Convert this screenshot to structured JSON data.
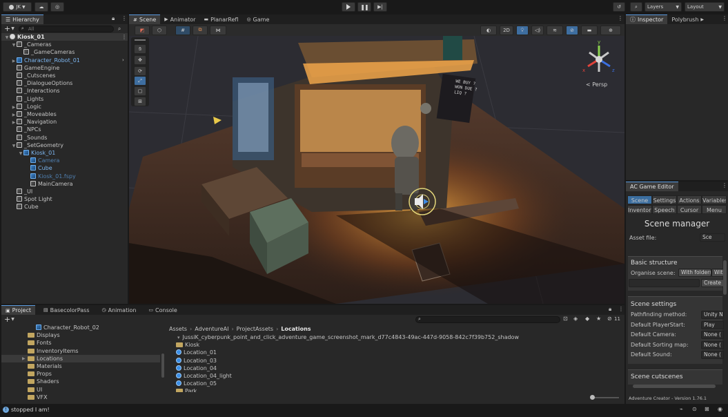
{
  "toolbar": {
    "account": "JK",
    "layers": "Layers",
    "layout": "Layout"
  },
  "hierarchy": {
    "tab": "Hierarchy",
    "search_placeholder": "All",
    "items": [
      {
        "label": "Kiosk_01",
        "indent": 0,
        "icon": "unity-scene-icon",
        "arrow": "down",
        "color": "#e6e6e6",
        "bold": true
      },
      {
        "label": "_Cameras",
        "indent": 1,
        "icon": "gameobject-icon",
        "arrow": "down",
        "color": "#c4c4c4"
      },
      {
        "label": "_GameCameras",
        "indent": 2,
        "icon": "gameobject-icon",
        "arrow": "",
        "color": "#c4c4c4"
      },
      {
        "label": "Character_Robot_01",
        "indent": 1,
        "icon": "prefab-icon",
        "arrow": "right",
        "color": "#7db6f0"
      },
      {
        "label": "GameEngine",
        "indent": 1,
        "icon": "gameobject-icon",
        "arrow": "",
        "color": "#c4c4c4"
      },
      {
        "label": "_Cutscenes",
        "indent": 1,
        "icon": "gameobject-icon",
        "arrow": "",
        "color": "#c4c4c4"
      },
      {
        "label": "_DialogueOptions",
        "indent": 1,
        "icon": "gameobject-icon",
        "arrow": "",
        "color": "#c4c4c4"
      },
      {
        "label": "_Interactions",
        "indent": 1,
        "icon": "gameobject-icon",
        "arrow": "",
        "color": "#c4c4c4"
      },
      {
        "label": "_Lights",
        "indent": 1,
        "icon": "gameobject-icon",
        "arrow": "",
        "color": "#c4c4c4"
      },
      {
        "label": "_Logic",
        "indent": 1,
        "icon": "gameobject-icon",
        "arrow": "right",
        "color": "#c4c4c4"
      },
      {
        "label": "_Moveables",
        "indent": 1,
        "icon": "gameobject-icon",
        "arrow": "right",
        "color": "#c4c4c4"
      },
      {
        "label": "_Navigation",
        "indent": 1,
        "icon": "gameobject-icon",
        "arrow": "right",
        "color": "#c4c4c4"
      },
      {
        "label": "_NPCs",
        "indent": 1,
        "icon": "gameobject-icon",
        "arrow": "",
        "color": "#c4c4c4"
      },
      {
        "label": "_Sounds",
        "indent": 1,
        "icon": "gameobject-icon",
        "arrow": "",
        "color": "#c4c4c4"
      },
      {
        "label": "_SetGeometry",
        "indent": 1,
        "icon": "gameobject-icon",
        "arrow": "down",
        "color": "#c4c4c4"
      },
      {
        "label": "Kiosk_01",
        "indent": 2,
        "icon": "prefab-icon",
        "arrow": "down",
        "color": "#7db6f0"
      },
      {
        "label": "Camera",
        "indent": 3,
        "icon": "prefab-icon",
        "arrow": "",
        "color": "#4f7fb0"
      },
      {
        "label": "Cube",
        "indent": 3,
        "icon": "prefab-icon",
        "arrow": "",
        "color": "#7db6f0"
      },
      {
        "label": "Kiosk_01.fspy",
        "indent": 3,
        "icon": "prefab-icon",
        "arrow": "",
        "color": "#4f7fb0"
      },
      {
        "label": "MainCamera",
        "indent": 3,
        "icon": "gameobject-icon",
        "arrow": "",
        "color": "#c4c4c4"
      },
      {
        "label": "_UI",
        "indent": 1,
        "icon": "gameobject-icon",
        "arrow": "",
        "color": "#c4c4c4"
      },
      {
        "label": "Spot Light",
        "indent": 1,
        "icon": "gameobject-icon",
        "arrow": "",
        "color": "#c4c4c4"
      },
      {
        "label": "Cube",
        "indent": 1,
        "icon": "gameobject-icon",
        "arrow": "",
        "color": "#c4c4c4"
      }
    ]
  },
  "scene": {
    "tabs": [
      {
        "label": "Scene",
        "active": true
      },
      {
        "label": "Animator",
        "active": false
      },
      {
        "label": "PlanarRefl",
        "active": false
      },
      {
        "label": "Game",
        "active": false
      }
    ],
    "mode_2d": "2D",
    "persp": "< Persp",
    "gizmo_axes": {
      "y": "y",
      "x": "x",
      "z": "z"
    },
    "sign_text": "WE BUY ? WON DUE ? LIQ ?"
  },
  "inspector": {
    "tabs": [
      "Inspector",
      "Polybrush"
    ]
  },
  "ac_editor": {
    "tab": "AC Game Editor",
    "tabs_row1": [
      "Scene",
      "Settings",
      "Actions",
      "Variables"
    ],
    "tabs_row2": [
      "Inventory",
      "Speech",
      "Cursor",
      "Menu"
    ],
    "title": "Scene manager",
    "asset_file_label": "Asset file:",
    "asset_file_value": "Sce",
    "basic_structure": "Basic structure",
    "organise_label": "Organise scene:",
    "organise_value": "With folders",
    "organise_value2": "With",
    "create_button": "Create",
    "scene_settings": "Scene settings",
    "settings": [
      {
        "label": "Pathfinding method:",
        "value": "Unity N"
      },
      {
        "label": "Default PlayerStart:",
        "value": "Play"
      },
      {
        "label": "Default Camera:",
        "value": "None ("
      },
      {
        "label": "Default Sorting map:",
        "value": "None ("
      },
      {
        "label": "Default Sound:",
        "value": "None ("
      }
    ],
    "scene_cutscenes": "Scene cutscenes",
    "version": "Adventure Creator - Version 1.76.1"
  },
  "project": {
    "tabs": [
      "Project",
      "BasecolorPass",
      "Animation",
      "Console"
    ],
    "count": "11",
    "breadcrumb": [
      "Assets",
      "AdventureAI",
      "ProjectAssets",
      "Locations"
    ],
    "folders": [
      "Character_Robot_02",
      "Displays",
      "Fonts",
      "InventoryItems",
      "Locations",
      "Materials",
      "Props",
      "Shaders",
      "UI",
      "VFX"
    ],
    "selected_folder": "Locations",
    "files": [
      {
        "label": "JussiK_cyberpunk_point_and_click_adventure_game_screenshot_mark_d77c4843-49ac-447d-9058-842c7f39b752_shadow",
        "icon": "image"
      },
      {
        "label": "Kiosk",
        "icon": "folder"
      },
      {
        "label": "Location_01",
        "icon": "scene"
      },
      {
        "label": "Location_03",
        "icon": "scene"
      },
      {
        "label": "Location_04",
        "icon": "scene"
      },
      {
        "label": "Location_04_light",
        "icon": "scene"
      },
      {
        "label": "Location_05",
        "icon": "scene"
      },
      {
        "label": "Park",
        "icon": "folder"
      }
    ]
  },
  "status": {
    "message": "stopped I am!"
  },
  "colors": {
    "accent": "#3b8ee6",
    "panel": "#282828",
    "header": "#1e1e1e",
    "selection": "#2c5d87"
  }
}
